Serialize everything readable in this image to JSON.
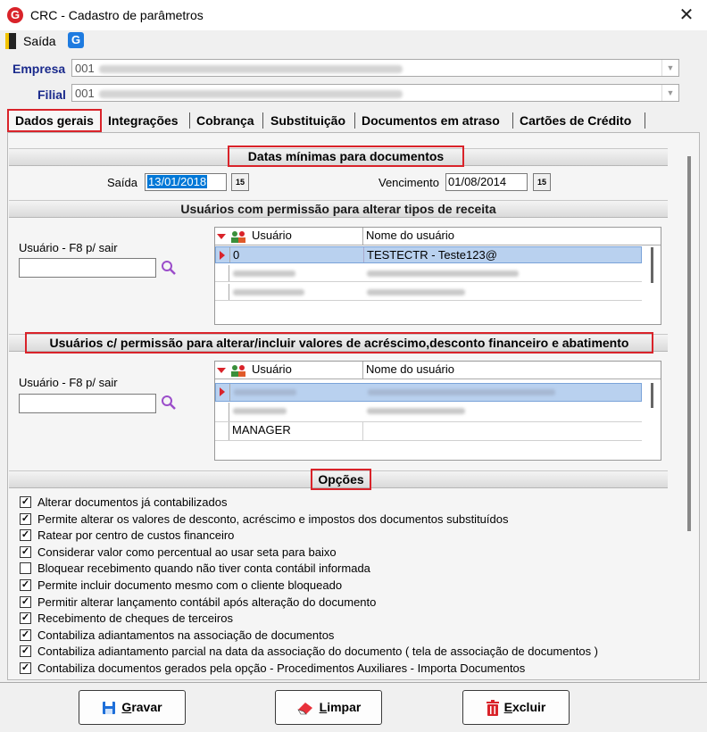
{
  "window": {
    "title": "CRC - Cadastro de parâmetros",
    "close_symbol": "✕"
  },
  "toolbar": {
    "exit_label": "Saída"
  },
  "company": {
    "empresa_label": "Empresa",
    "empresa_code": "001",
    "filial_label": "Filial",
    "filial_code": "001"
  },
  "tabs": [
    {
      "label": "Dados gerais"
    },
    {
      "label": "Integrações"
    },
    {
      "label": "Cobrança"
    },
    {
      "label": "Substituição"
    },
    {
      "label": "Documentos em atraso"
    },
    {
      "label": "Cartões de Crédito"
    }
  ],
  "dates_section": {
    "title": "Datas mínimas para documentos",
    "saida_label": "Saída",
    "saida_value": "13/01/2018",
    "vencimento_label": "Vencimento",
    "vencimento_value": "01/08/2014",
    "calendar_glyph": "15"
  },
  "revenue_section": {
    "title": "Usuários com permissão para alterar tipos de receita",
    "user_label": "Usuário - F8 p/ sair",
    "grid": {
      "col_user": "Usuário",
      "col_name": "Nome do usuário",
      "rows": [
        {
          "user": "0",
          "name": "TESTECTR - Teste123@"
        }
      ]
    }
  },
  "discount_section": {
    "title": "Usuários c/ permissão para alterar/incluir valores de acréscimo,desconto financeiro e abatimento",
    "user_label": "Usuário - F8 p/ sair",
    "grid": {
      "col_user": "Usuário",
      "col_name": "Nome do usuário",
      "rows": [
        {
          "user": "MANAGER",
          "name": ""
        }
      ]
    }
  },
  "options_section": {
    "title": "Opções",
    "items": [
      {
        "label": "Alterar documentos já contabilizados",
        "checked": true
      },
      {
        "label": "Permite alterar os valores de desconto, acréscimo  e impostos dos documentos substituídos",
        "checked": true
      },
      {
        "label": "Ratear por centro de custos financeiro",
        "checked": true
      },
      {
        "label": "Considerar valor como percentual ao usar seta para baixo",
        "checked": true
      },
      {
        "label": "Bloquear recebimento quando não tiver conta contábil informada",
        "checked": false
      },
      {
        "label": "Permite incluir documento mesmo com o cliente bloqueado",
        "checked": true
      },
      {
        "label": "Permitir alterar lançamento contábil após alteração do documento",
        "checked": true
      },
      {
        "label": "Recebimento de cheques de terceiros",
        "checked": true
      },
      {
        "label": "Contabiliza adiantamentos na associação de documentos",
        "checked": true
      },
      {
        "label": "Contabiliza adiantamento parcial na data da associação do documento ( tela de associação de documentos )",
        "checked": true
      },
      {
        "label": "Contabiliza documentos gerados pela opção - Procedimentos Auxiliares - Importa Documentos",
        "checked": true
      }
    ]
  },
  "buttons": {
    "save_mn": "G",
    "save_rest": "ravar",
    "clear_mn": "L",
    "clear_rest": "impar",
    "delete_mn": "E",
    "delete_rest": "xcluir"
  },
  "colors": {
    "accent_red": "#d9232a",
    "selection_blue": "#0078d7",
    "label_blue": "#1a2a8c"
  }
}
